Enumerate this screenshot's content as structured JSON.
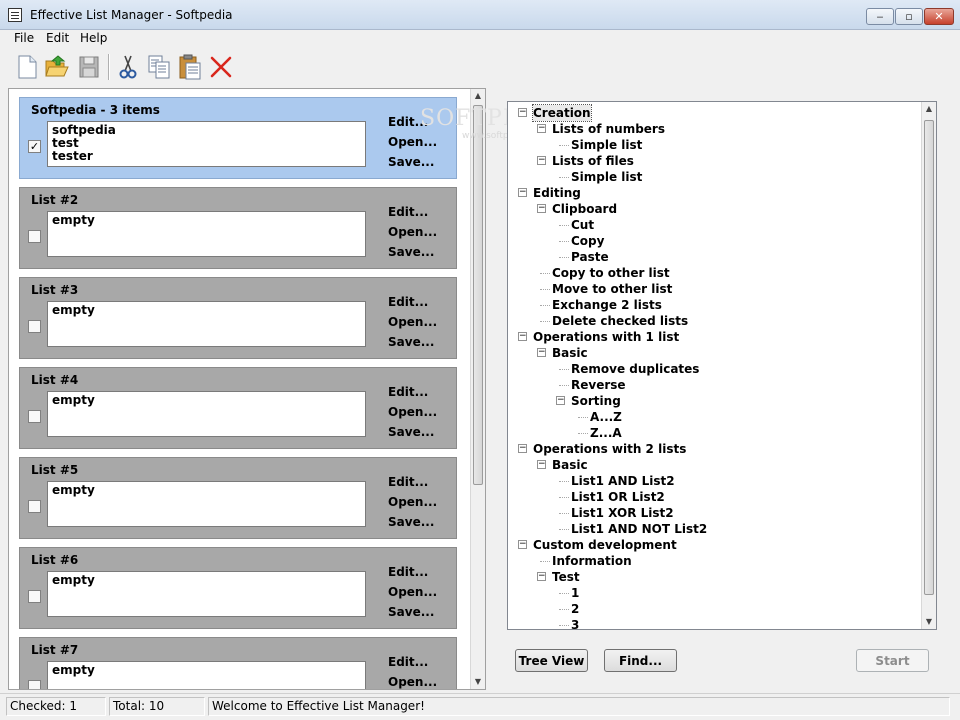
{
  "window": {
    "title": "Effective List Manager - Softpedia",
    "controls": {
      "minimize": "‒",
      "maximize": "▫",
      "close": "✕"
    }
  },
  "menu": [
    "File",
    "Edit",
    "Help"
  ],
  "toolbar": {
    "icons": [
      "new-document-icon",
      "open-folder-icon",
      "save-disk-icon",
      "cut-scissors-icon",
      "copy-icon",
      "paste-clipboard-icon",
      "delete-x-icon"
    ],
    "colors": {
      "folder": "#f2c14e",
      "delete": "#d9261c",
      "scissors": "#2c5aa0"
    }
  },
  "lists": [
    {
      "title": "Softpedia - 3 items",
      "items": [
        "softpedia",
        "test",
        "tester"
      ],
      "checked": true,
      "selected": true
    },
    {
      "title": "List #2",
      "items": [
        "empty"
      ],
      "checked": false,
      "selected": false
    },
    {
      "title": "List #3",
      "items": [
        "empty"
      ],
      "checked": false,
      "selected": false
    },
    {
      "title": "List #4",
      "items": [
        "empty"
      ],
      "checked": false,
      "selected": false
    },
    {
      "title": "List #5",
      "items": [
        "empty"
      ],
      "checked": false,
      "selected": false
    },
    {
      "title": "List #6",
      "items": [
        "empty"
      ],
      "checked": false,
      "selected": false
    },
    {
      "title": "List #7",
      "items": [
        "empty"
      ],
      "checked": false,
      "selected": false
    }
  ],
  "list_actions": [
    "Edit...",
    "Open...",
    "Save..."
  ],
  "tree": [
    {
      "label": "Creation",
      "depth": 0,
      "expanded": true,
      "selected": true
    },
    {
      "label": "Lists of numbers",
      "depth": 1,
      "expanded": true
    },
    {
      "label": "Simple list",
      "depth": 2
    },
    {
      "label": "Lists of files",
      "depth": 1,
      "expanded": true
    },
    {
      "label": "Simple list",
      "depth": 2
    },
    {
      "label": "Editing",
      "depth": 0,
      "expanded": true
    },
    {
      "label": "Clipboard",
      "depth": 1,
      "expanded": true
    },
    {
      "label": "Cut",
      "depth": 2
    },
    {
      "label": "Copy",
      "depth": 2
    },
    {
      "label": "Paste",
      "depth": 2
    },
    {
      "label": "Copy to other list",
      "depth": 1
    },
    {
      "label": "Move to other list",
      "depth": 1
    },
    {
      "label": "Exchange 2 lists",
      "depth": 1
    },
    {
      "label": "Delete checked lists",
      "depth": 1
    },
    {
      "label": "Operations with 1 list",
      "depth": 0,
      "expanded": true
    },
    {
      "label": "Basic",
      "depth": 1,
      "expanded": true
    },
    {
      "label": "Remove duplicates",
      "depth": 2
    },
    {
      "label": "Reverse",
      "depth": 2
    },
    {
      "label": "Sorting",
      "depth": 2,
      "expanded": true
    },
    {
      "label": "A...Z",
      "depth": 3
    },
    {
      "label": "Z...A",
      "depth": 3
    },
    {
      "label": "Operations with 2 lists",
      "depth": 0,
      "expanded": true
    },
    {
      "label": "Basic",
      "depth": 1,
      "expanded": true
    },
    {
      "label": "List1 AND List2",
      "depth": 2
    },
    {
      "label": "List1 OR List2",
      "depth": 2
    },
    {
      "label": "List1 XOR List2",
      "depth": 2
    },
    {
      "label": "List1 AND NOT List2",
      "depth": 2
    },
    {
      "label": "Custom development",
      "depth": 0,
      "expanded": true
    },
    {
      "label": "Information",
      "depth": 1
    },
    {
      "label": "Test",
      "depth": 1,
      "expanded": true
    },
    {
      "label": "1",
      "depth": 2
    },
    {
      "label": "2",
      "depth": 2
    },
    {
      "label": "3",
      "depth": 2
    }
  ],
  "buttons": {
    "tree_view": "Tree View",
    "find": "Find...",
    "start": "Start"
  },
  "status": {
    "checked": "Checked: 1",
    "total": "Total: 10",
    "message": "Welcome to Effective List Manager!"
  },
  "watermark": {
    "main": "SOFTPEDIA",
    "sub": "www.softpedia.com"
  }
}
